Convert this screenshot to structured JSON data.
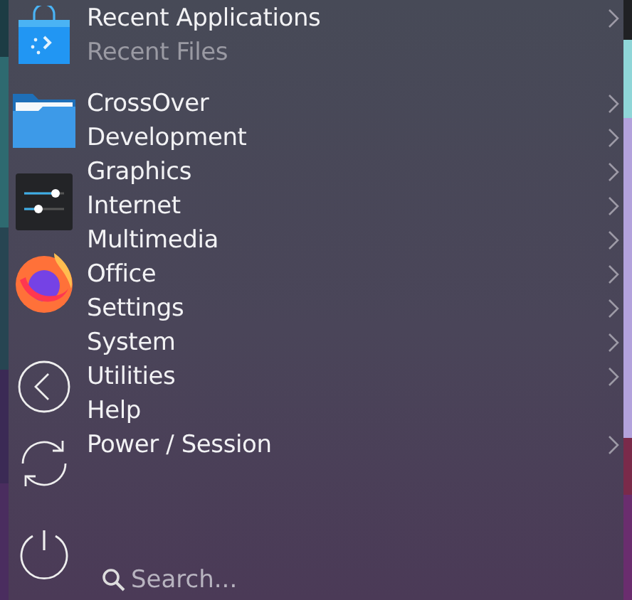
{
  "sections": [
    {
      "items": [
        {
          "label": "Recent Applications",
          "dimmed": false,
          "submenu": true
        },
        {
          "label": "Recent Files",
          "dimmed": true,
          "submenu": false
        }
      ]
    },
    {
      "items": [
        {
          "label": "CrossOver",
          "dimmed": false,
          "submenu": true
        },
        {
          "label": "Development",
          "dimmed": false,
          "submenu": true
        },
        {
          "label": "Graphics",
          "dimmed": false,
          "submenu": true
        },
        {
          "label": "Internet",
          "dimmed": false,
          "submenu": true
        },
        {
          "label": "Multimedia",
          "dimmed": false,
          "submenu": true
        },
        {
          "label": "Office",
          "dimmed": false,
          "submenu": true
        },
        {
          "label": "Settings",
          "dimmed": false,
          "submenu": true
        },
        {
          "label": "System",
          "dimmed": false,
          "submenu": true
        },
        {
          "label": "Utilities",
          "dimmed": false,
          "submenu": true
        },
        {
          "label": "Help",
          "dimmed": false,
          "submenu": false
        },
        {
          "label": "Power / Session",
          "dimmed": false,
          "submenu": true
        }
      ]
    }
  ],
  "search": {
    "placeholder": "Search..."
  }
}
